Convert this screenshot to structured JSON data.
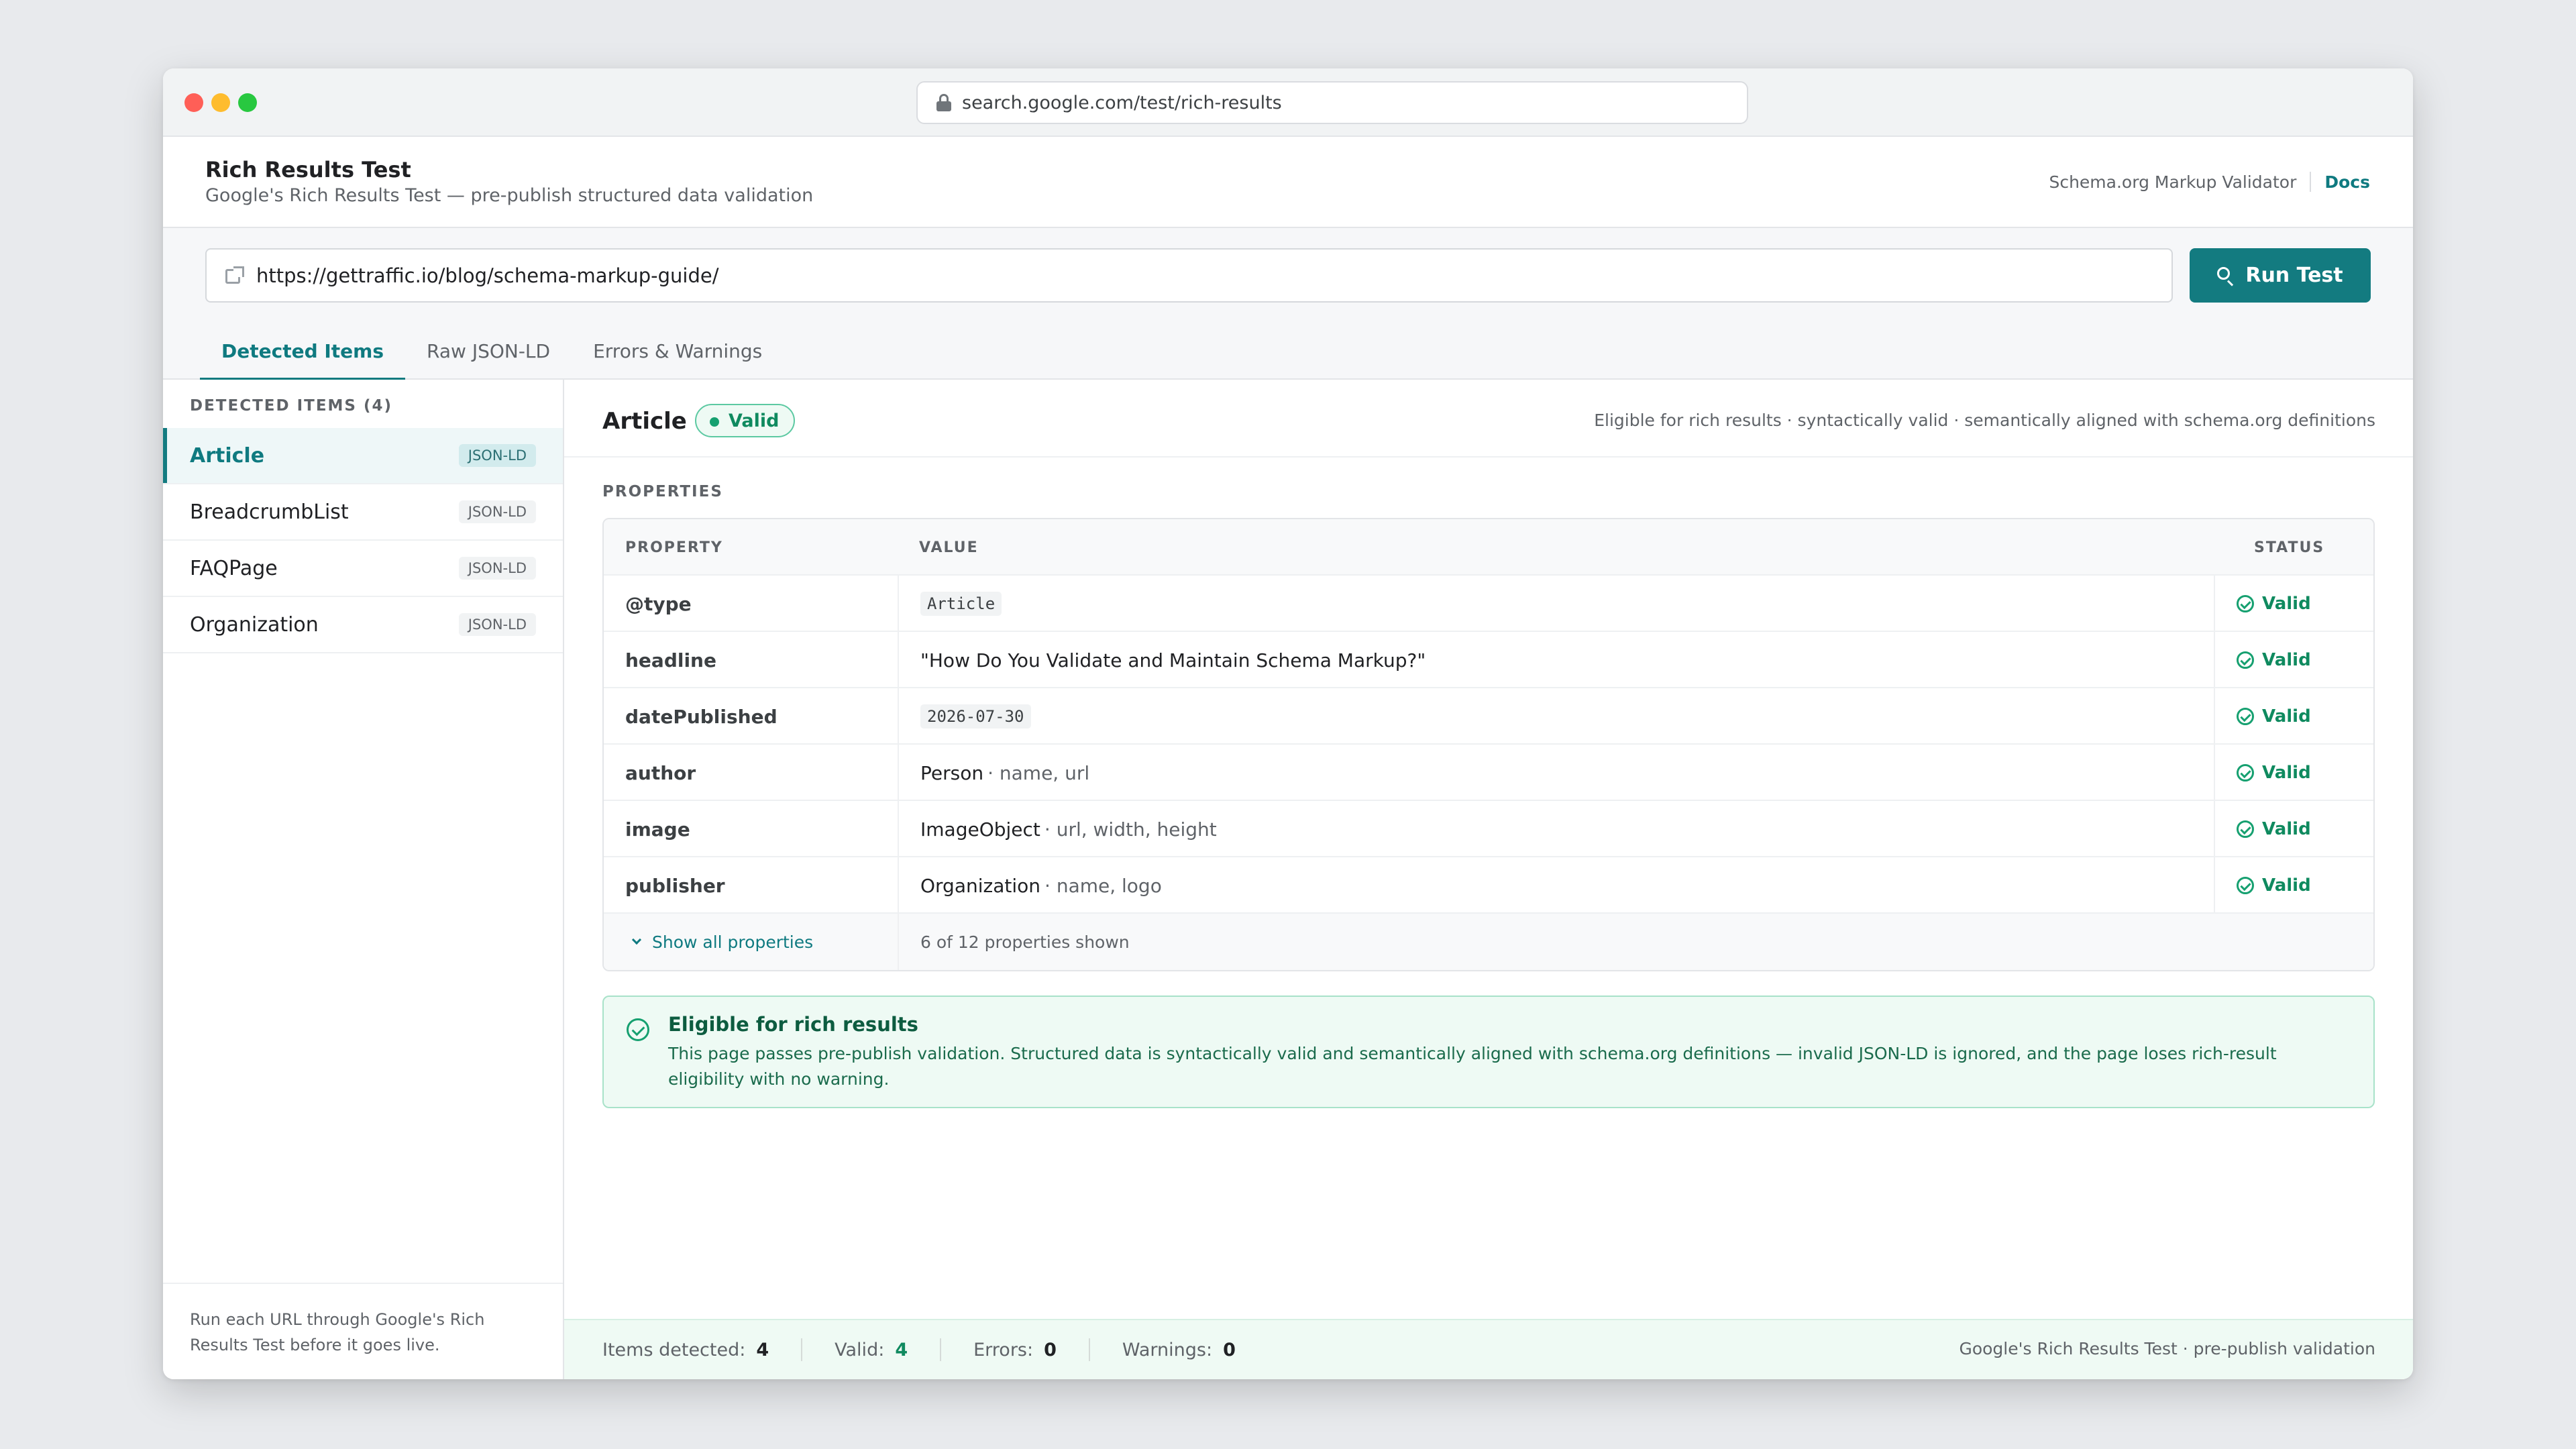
{
  "browser": {
    "url": "search.google.com/test/rich-results"
  },
  "header": {
    "title": "Rich Results Test",
    "subtitle": "Google's Rich Results Test — pre-publish structured data validation",
    "validator_label": "Schema.org Markup Validator",
    "docs_label": "Docs"
  },
  "url_input": {
    "value": "https://gettraffic.io/blog/schema-markup-guide/",
    "run_label": "Run Test"
  },
  "tabs": [
    {
      "label": "Detected Items",
      "active": true
    },
    {
      "label": "Raw JSON-LD",
      "active": false
    },
    {
      "label": "Errors & Warnings",
      "active": false
    }
  ],
  "sidebar": {
    "heading": "DETECTED ITEMS (4)",
    "items": [
      {
        "label": "Article",
        "badge": "JSON-LD",
        "active": true
      },
      {
        "label": "BreadcrumbList",
        "badge": "JSON-LD",
        "active": false
      },
      {
        "label": "FAQPage",
        "badge": "JSON-LD",
        "active": false
      },
      {
        "label": "Organization",
        "badge": "JSON-LD",
        "active": false
      }
    ],
    "footer": "Run each URL through Google's Rich Results Test before it goes live."
  },
  "item": {
    "title": "Article",
    "status": "Valid",
    "summary": "Eligible for rich results · syntactically valid · semantically aligned with schema.org definitions"
  },
  "properties": {
    "heading": "PROPERTIES",
    "columns": {
      "property": "PROPERTY",
      "value": "VALUE",
      "status": "STATUS"
    },
    "rows": [
      {
        "property": "@type",
        "value": "Article",
        "sub": "",
        "code": true,
        "status": "Valid"
      },
      {
        "property": "headline",
        "value": "\"How Do You Validate and Maintain Schema Markup?\"",
        "sub": "",
        "code": false,
        "status": "Valid"
      },
      {
        "property": "datePublished",
        "value": "2026-07-30",
        "sub": "",
        "code": true,
        "status": "Valid"
      },
      {
        "property": "author",
        "value": "Person",
        "sub": "· name, url",
        "code": false,
        "status": "Valid"
      },
      {
        "property": "image",
        "value": "ImageObject",
        "sub": "· url, width, height",
        "code": false,
        "status": "Valid"
      },
      {
        "property": "publisher",
        "value": "Organization",
        "sub": "· name, logo",
        "code": false,
        "status": "Valid"
      }
    ],
    "show_all_label": "Show all properties",
    "shown_count": "6 of 12 properties shown"
  },
  "eligible": {
    "title": "Eligible for rich results",
    "text": "This page passes pre-publish validation. Structured data is syntactically valid and semantically aligned with schema.org definitions — invalid JSON-LD is ignored, and the page loses rich-result eligibility with no warning."
  },
  "statusbar": {
    "items_label": "Items detected:",
    "items_value": "4",
    "valid_label": "Valid:",
    "valid_value": "4",
    "errors_label": "Errors:",
    "errors_value": "0",
    "warnings_label": "Warnings:",
    "warnings_value": "0",
    "right_text": "Google's Rich Results Test · pre-publish validation"
  },
  "colors": {
    "accent": "#137b80",
    "valid": "#16a070",
    "eligible_bg": "#eefaf4"
  },
  "icons": [
    "lock-icon",
    "external-link-icon",
    "search-icon",
    "check-circle-icon",
    "chevron-down-icon"
  ]
}
